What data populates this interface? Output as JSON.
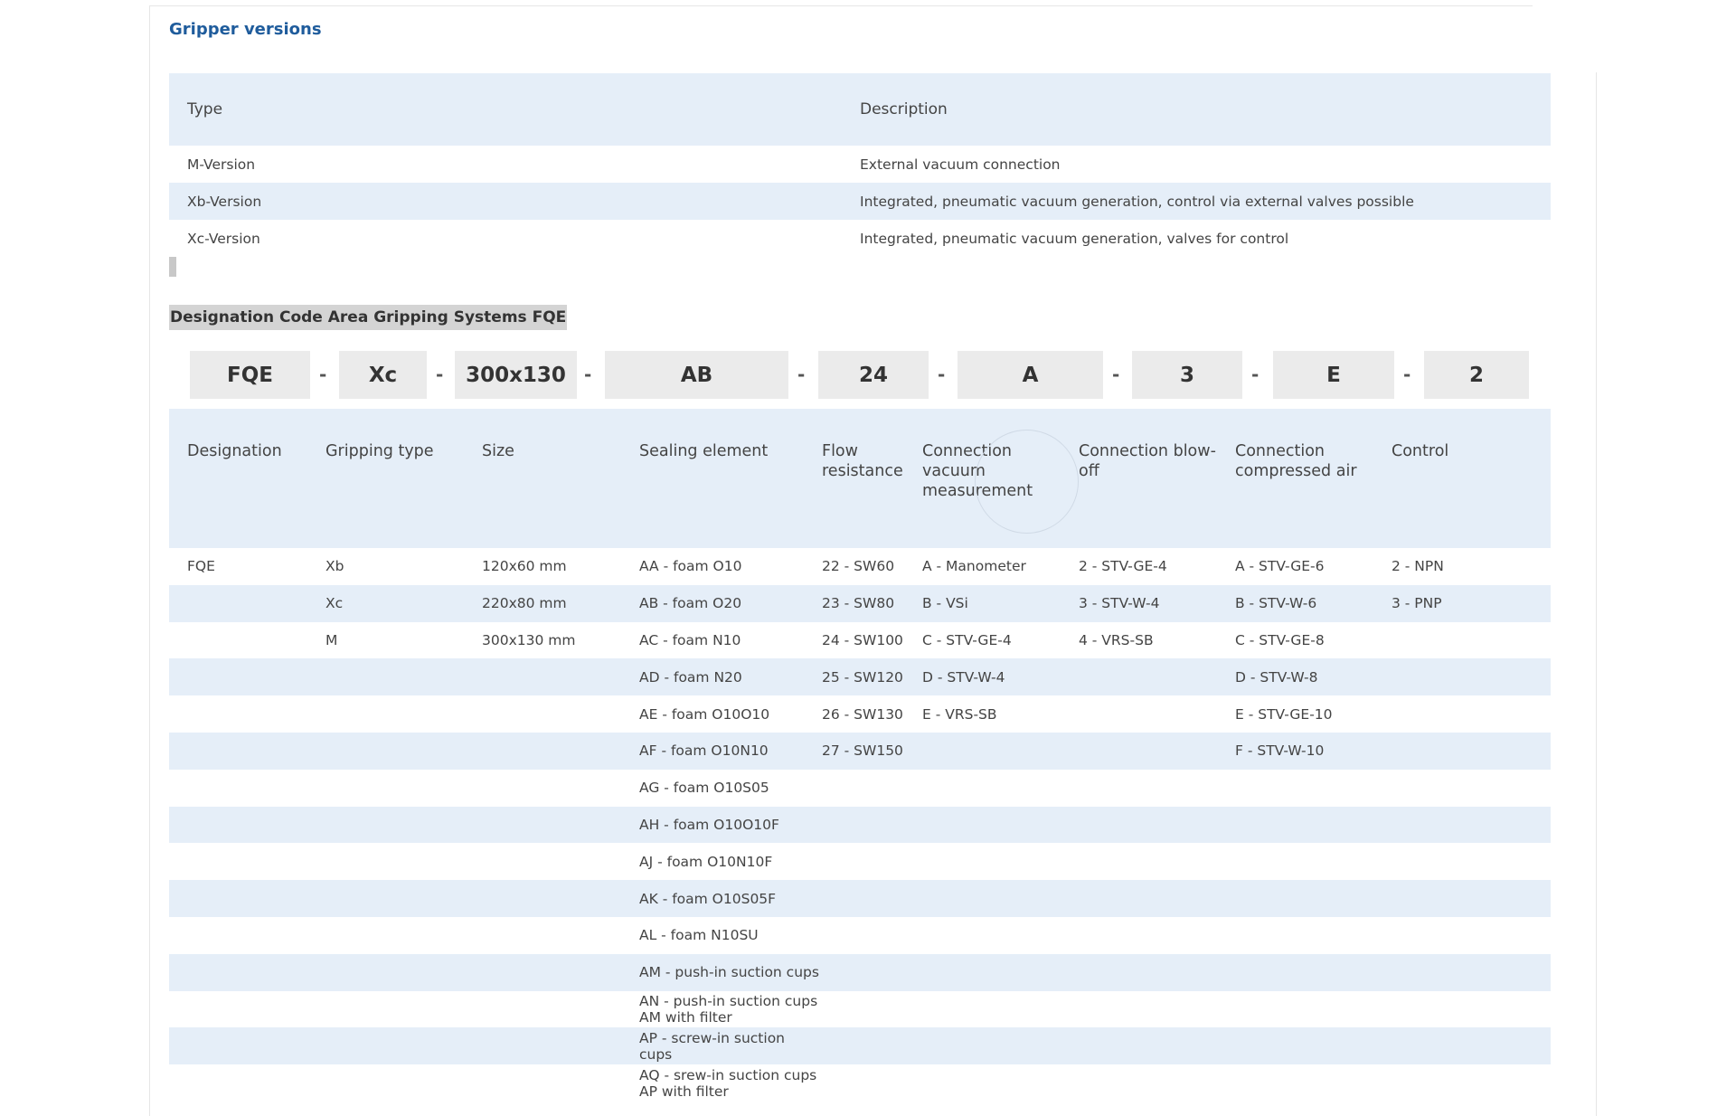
{
  "section_title": "Gripper versions",
  "versions": {
    "headers": [
      "Type",
      "Description"
    ],
    "rows": [
      [
        "M-Version",
        "External vacuum connection"
      ],
      [
        "Xb-Version",
        "Integrated, pneumatic vacuum generation, control via external valves possible"
      ],
      [
        "Xc-Version",
        "Integrated, pneumatic vacuum generation, valves for control"
      ]
    ]
  },
  "code_title": "Designation Code Area Gripping Systems FQE",
  "code": {
    "parts": [
      "FQE",
      "Xc",
      "300x130",
      "AB",
      "24",
      "A",
      "3",
      "E",
      "2"
    ],
    "separator": "-"
  },
  "designation": {
    "headers": [
      "Designation",
      "Gripping type",
      "Size",
      "Sealing element",
      "Flow resistance",
      "Connection vacuum measurement",
      "Connection blow-off",
      "Connection compressed air",
      "Control"
    ],
    "rows": [
      [
        "FQE",
        "Xb",
        "120x60 mm",
        "AA - foam O10",
        "22 - SW60",
        "A - Manometer",
        "2 - STV-GE-4",
        "A - STV-GE-6",
        "2 - NPN"
      ],
      [
        "",
        "Xc",
        "220x80 mm",
        "AB - foam O20",
        "23 - SW80",
        "B - VSi",
        "3 - STV-W-4",
        "B - STV-W-6",
        "3 - PNP"
      ],
      [
        "",
        "M",
        "300x130 mm",
        "AC - foam N10",
        "24 - SW100",
        "C - STV-GE-4",
        "4 - VRS-SB",
        "C - STV-GE-8",
        ""
      ],
      [
        "",
        "",
        "",
        "AD - foam N20",
        "25 - SW120",
        "D - STV-W-4",
        "",
        "D - STV-W-8",
        ""
      ],
      [
        "",
        "",
        "",
        "AE - foam O10O10",
        "26 - SW130",
        "E - VRS-SB",
        "",
        "E - STV-GE-10",
        ""
      ],
      [
        "",
        "",
        "",
        "AF - foam O10N10",
        "27 - SW150",
        "",
        "",
        "F - STV-W-10",
        ""
      ],
      [
        "",
        "",
        "",
        "AG - foam O10S05",
        "",
        "",
        "",
        "",
        ""
      ],
      [
        "",
        "",
        "",
        "AH - foam O10O10F",
        "",
        "",
        "",
        "",
        ""
      ],
      [
        "",
        "",
        "",
        "AJ - foam O10N10F",
        "",
        "",
        "",
        "",
        ""
      ],
      [
        "",
        "",
        "",
        "AK - foam O10S05F",
        "",
        "",
        "",
        "",
        ""
      ],
      [
        "",
        "",
        "",
        "AL - foam N10SU",
        "",
        "",
        "",
        "",
        ""
      ],
      [
        "",
        "",
        "",
        "AM - push-in suction cups",
        "",
        "",
        "",
        "",
        ""
      ],
      [
        "",
        "",
        "",
        "AN - push-in suction cups AM with filter",
        "",
        "",
        "",
        "",
        ""
      ],
      [
        "",
        "",
        "",
        "AP - screw-in suction cups",
        "",
        "",
        "",
        "",
        ""
      ],
      [
        "",
        "",
        "",
        "AQ - srew-in suction cups AP with filter",
        "",
        "",
        "",
        "",
        ""
      ]
    ]
  }
}
